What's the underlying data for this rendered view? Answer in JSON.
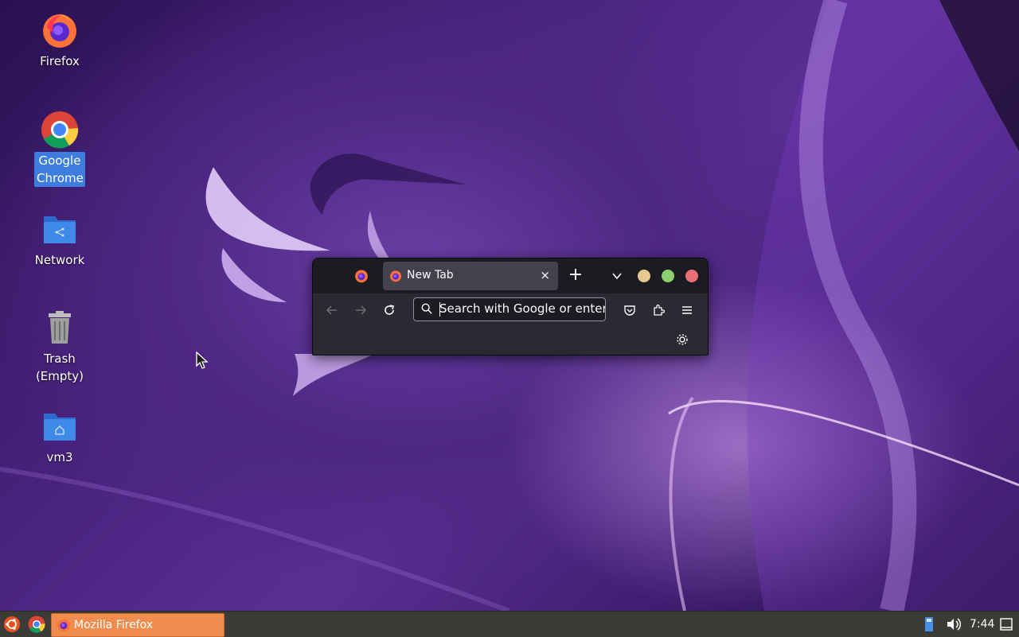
{
  "desktop": {
    "icons": [
      {
        "label": "Firefox"
      },
      {
        "label": "Google Chrome"
      },
      {
        "label": "Network"
      },
      {
        "label": "Trash (Empty)"
      },
      {
        "label": "vm3"
      }
    ]
  },
  "browser": {
    "tab_title": "New Tab",
    "tab_close": "×",
    "new_tab": "+",
    "url_placeholder": "Search with Google or enter address",
    "window_colors": {
      "minimize": "#e5c07b",
      "maximize": "#98c379",
      "close": "#e06c75"
    }
  },
  "taskbar": {
    "task_label": "Mozilla Firefox",
    "clock": "7:44"
  },
  "colors": {
    "taskbar_bg": "#3c3b37",
    "task_active": "#f08c4d",
    "selection": "#3d7de0"
  }
}
